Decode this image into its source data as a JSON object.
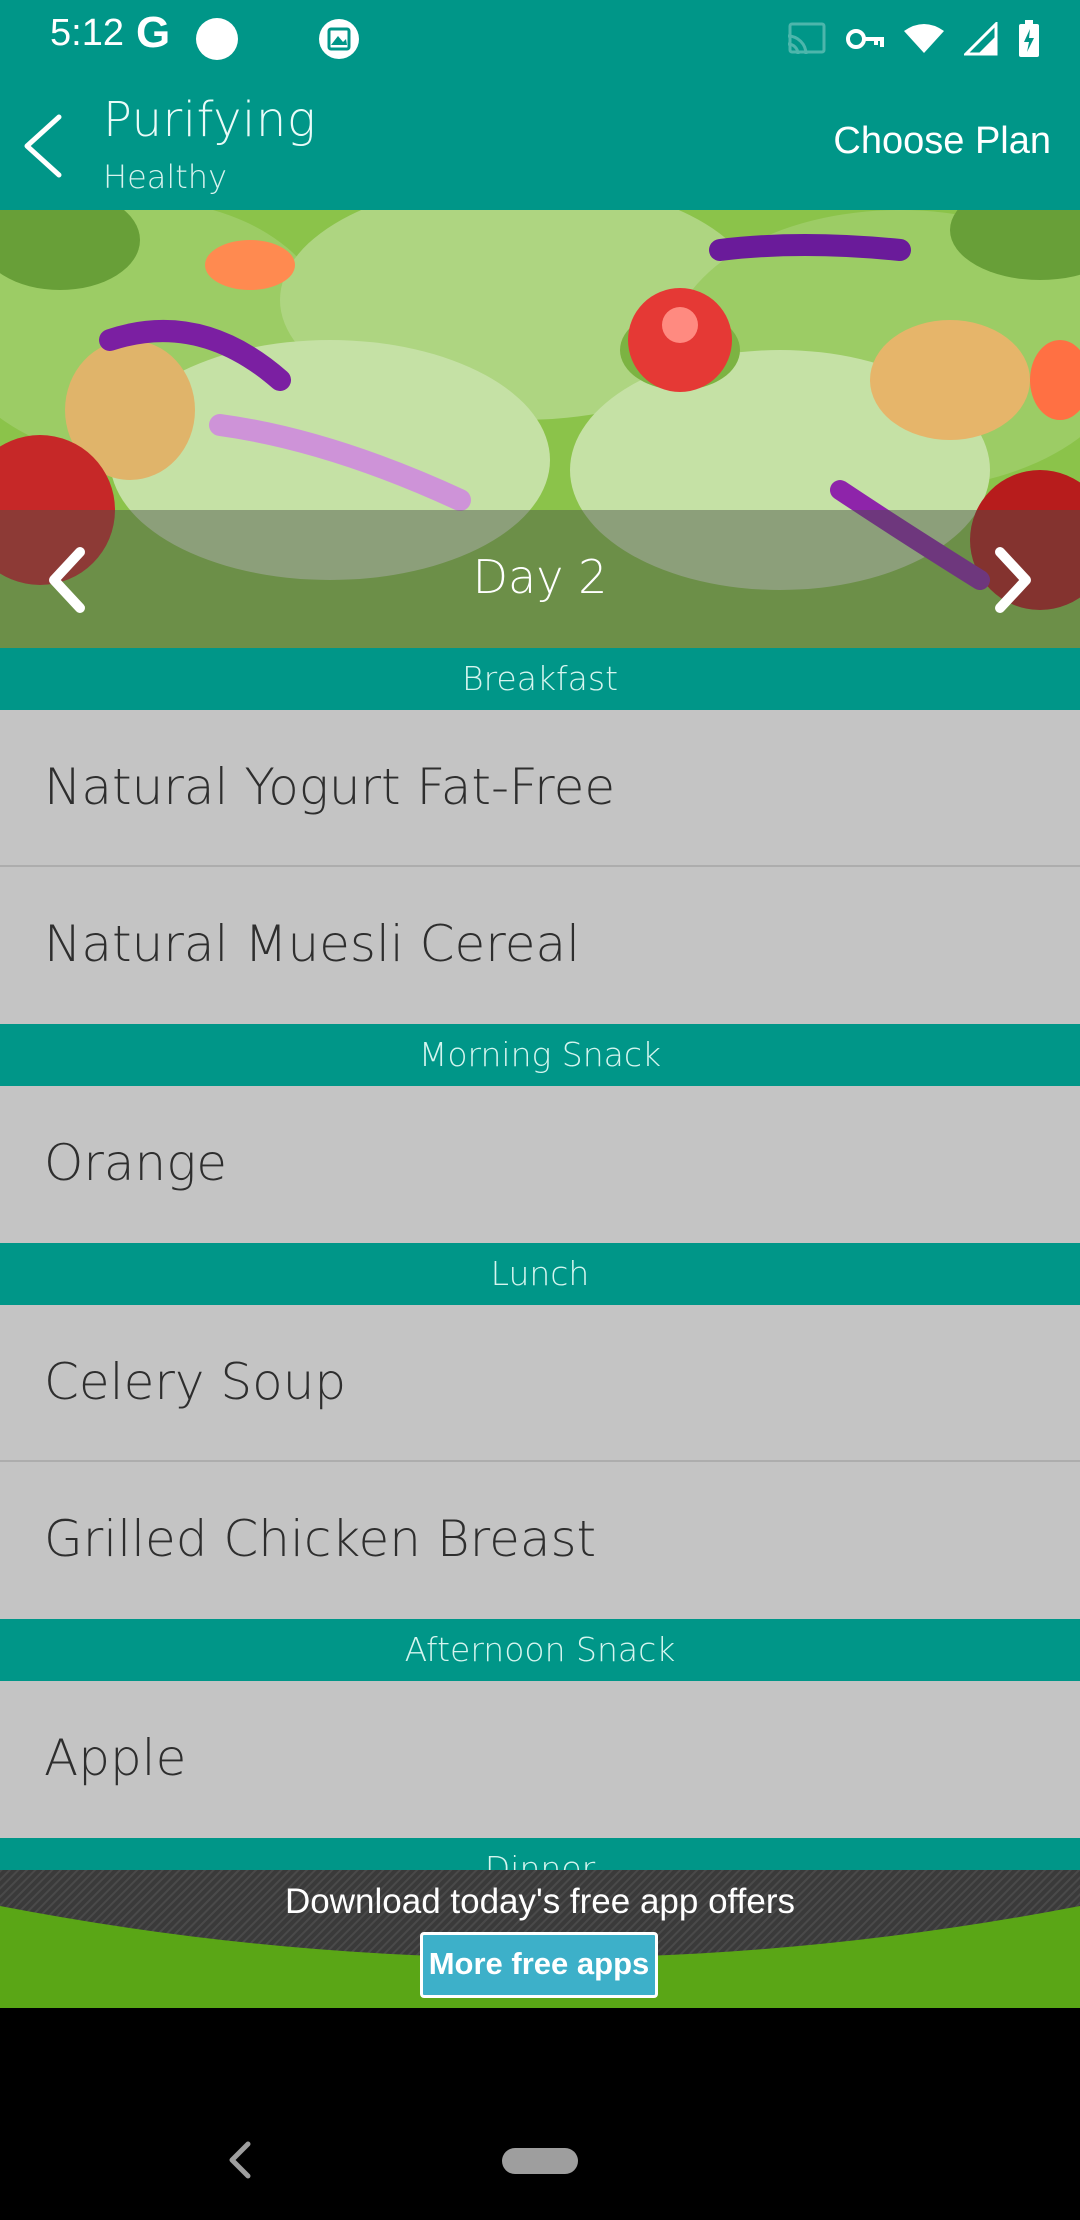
{
  "status_bar": {
    "time": "5:12",
    "carrier_glyph": "G",
    "icons": [
      "google-icon",
      "circle-notification-icon",
      "gallery-icon",
      "cast-icon",
      "vpn-key-icon",
      "wifi-icon",
      "signal-icon",
      "battery-charging-icon"
    ]
  },
  "app_bar": {
    "title": "Purifying",
    "subtitle": "Healthy",
    "action_label": "Choose Plan"
  },
  "hero": {
    "day_label": "Day 2"
  },
  "meals": [
    {
      "header": "Breakfast",
      "items": [
        "Natural Yogurt Fat-Free",
        "Natural Muesli Cereal"
      ]
    },
    {
      "header": "Morning Snack",
      "items": [
        "Orange"
      ]
    },
    {
      "header": "Lunch",
      "items": [
        "Celery Soup",
        "Grilled Chicken Breast"
      ]
    },
    {
      "header": "Afternoon Snack",
      "items": [
        "Apple"
      ]
    },
    {
      "header": "Dinner",
      "items": []
    }
  ],
  "ad": {
    "text": "Download today's free app offers",
    "button_label": "More free apps"
  },
  "colors": {
    "primary": "#009688",
    "list_background": "#c4c4c4",
    "ad_green": "#5aa616",
    "ad_button": "#3db0c9"
  }
}
